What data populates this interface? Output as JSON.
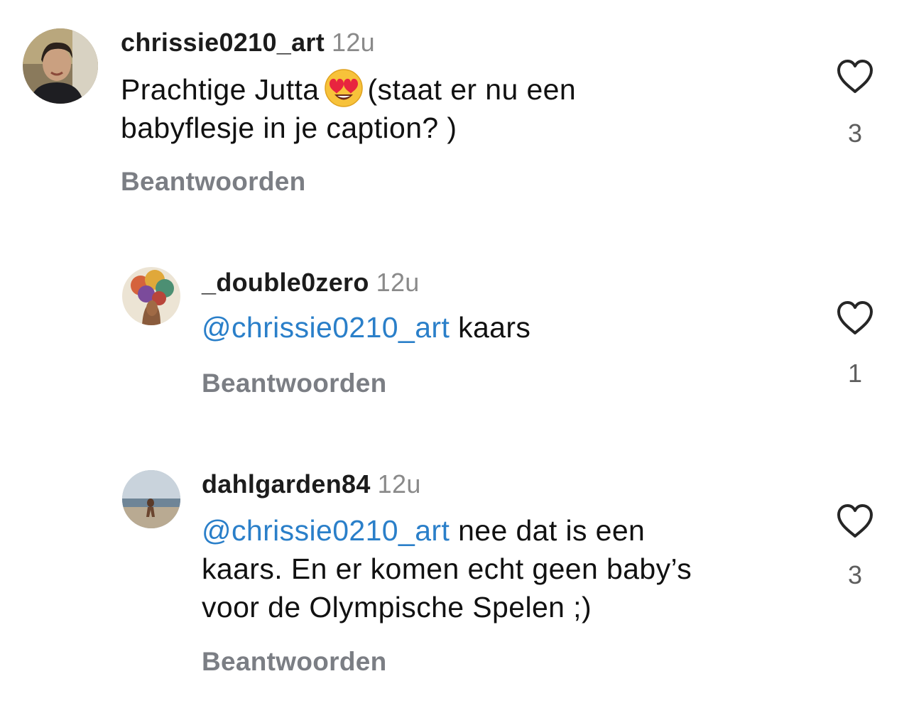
{
  "comments": [
    {
      "username": "chrissie0210_art",
      "time": "12u",
      "text_before": "Prachtige Jutta",
      "emoji": "smiling-face-with-heart-eyes",
      "text_after": "(staat er nu een",
      "text_line2": "babyflesje in je caption? )",
      "reply_label": "Beantwoorden",
      "like_count": "3"
    },
    {
      "username": "_double0zero",
      "time": "12u",
      "mention": "@chrissie0210_art",
      "text": "kaars",
      "reply_label": "Beantwoorden",
      "like_count": "1"
    },
    {
      "username": "dahlgarden84",
      "time": "12u",
      "mention": "@chrissie0210_art",
      "text_line1": "nee dat is een",
      "text_line2": "kaars. En er komen echt geen baby’s",
      "text_line3": "voor de Olympische Spelen ;)",
      "reply_label": "Beantwoorden",
      "like_count": "3"
    }
  ],
  "colors": {
    "mention": "#2a7fc9",
    "reply": "#7b7e84",
    "timestamp": "#8a8a8a",
    "heart_outline": "#262626"
  },
  "icons": {
    "like": "heart-outline-icon"
  }
}
